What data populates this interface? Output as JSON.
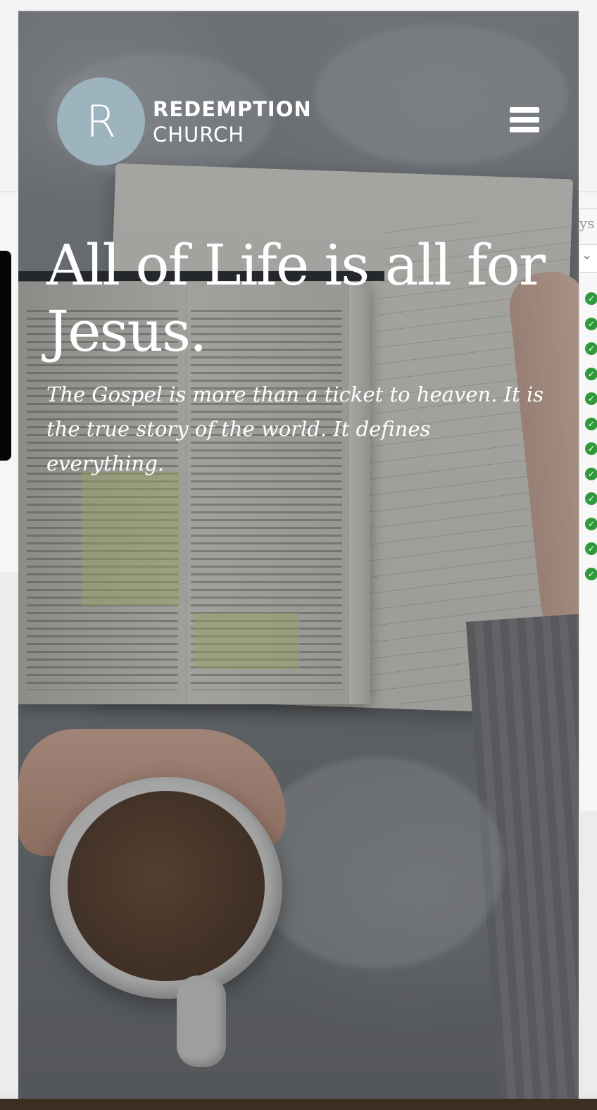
{
  "site": {
    "logo_mark": "R",
    "name_line1": "REDEMPTION",
    "name_line2": "CHURCH",
    "menu_icon": "hamburger-menu-icon"
  },
  "hero": {
    "title": "All of Life is all for Jesus.",
    "subtitle": "The Gospel is more than a ticket to heaven. It is the true story of the world. It defines everything.",
    "image_description": "open bible and notebook on grey blanket with coffee mug"
  },
  "background_window": {
    "partial_text": "ys",
    "dropdown_icon": "chevron-down-icon",
    "check_icon": "check-circle-icon",
    "check_count": 12
  },
  "colors": {
    "logo_circle": "#9db4bf",
    "hero_text": "#ffffff",
    "check_green": "#2f9a3b"
  }
}
